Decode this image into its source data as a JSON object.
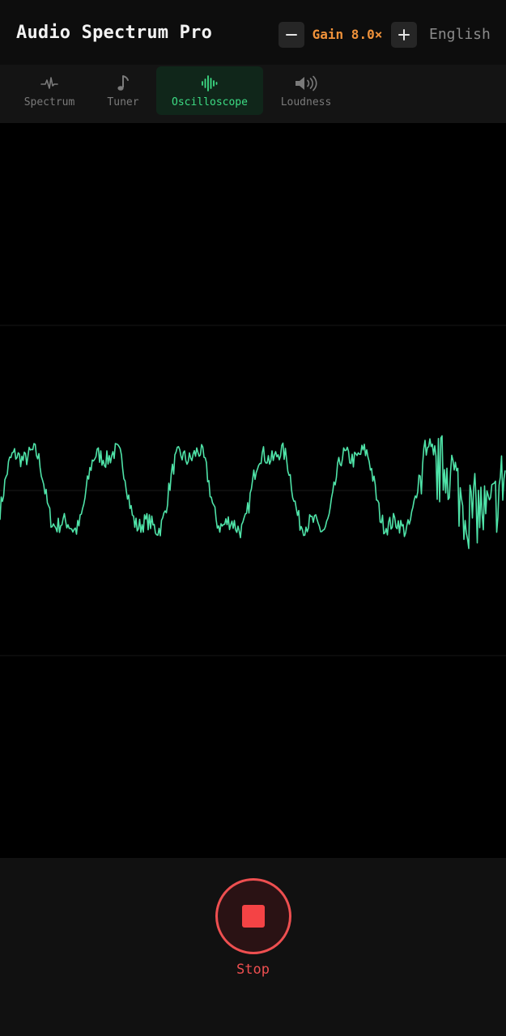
{
  "header": {
    "title": "Audio Spectrum Pro",
    "gain": {
      "label": "Gain 8.0×",
      "value": 8.0,
      "decrease_icon": "minus-icon",
      "increase_icon": "plus-icon",
      "color": "#f0923a"
    },
    "language": "English"
  },
  "tabs": [
    {
      "id": "spectrum",
      "label": "Spectrum",
      "icon": "pulse-icon",
      "active": false
    },
    {
      "id": "tuner",
      "label": "Tuner",
      "icon": "music-note-icon",
      "active": false
    },
    {
      "id": "oscilloscope",
      "label": "Oscilloscope",
      "icon": "waveform-icon",
      "active": true
    },
    {
      "id": "loudness",
      "label": "Loudness",
      "icon": "speaker-icon",
      "active": false
    }
  ],
  "colors": {
    "accent": "#3ddc84",
    "waveform": "#4fe3a8",
    "stop": "#ee4f50",
    "gain": "#f0923a"
  },
  "control": {
    "stop_label": "Stop",
    "stop_icon": "stop-icon",
    "recording": true
  }
}
